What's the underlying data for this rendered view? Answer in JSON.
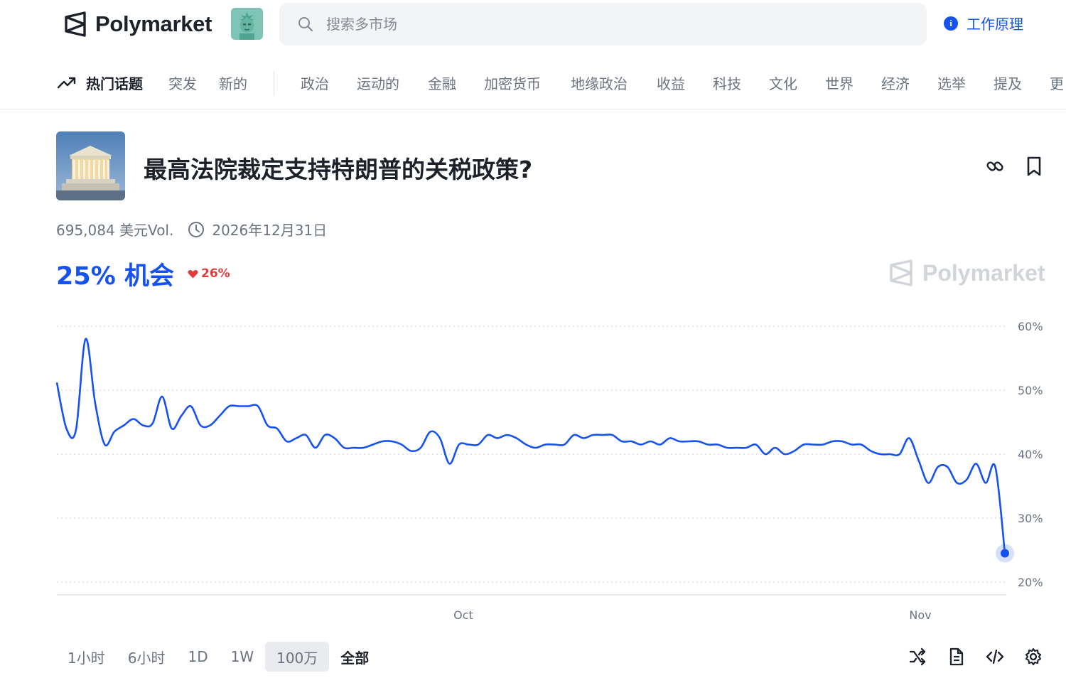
{
  "header": {
    "brand": "Polymarket",
    "search_placeholder": "搜索多市场",
    "how_it_works": "工作原理"
  },
  "nav": {
    "items": [
      {
        "label": "热门话题",
        "active": true
      },
      {
        "label": "突发"
      },
      {
        "label": "新的"
      },
      {
        "label": "政治"
      },
      {
        "label": "运动的"
      },
      {
        "label": "金融"
      },
      {
        "label": "加密货币"
      },
      {
        "label": "地缘政治"
      },
      {
        "label": "收益"
      },
      {
        "label": "科技"
      },
      {
        "label": "文化"
      },
      {
        "label": "世界"
      },
      {
        "label": "经济"
      },
      {
        "label": "选举"
      },
      {
        "label": "提及"
      },
      {
        "label": "更"
      }
    ]
  },
  "market": {
    "title": "最高法院裁定支持特朗普的关税政策?",
    "volume": "695,084 美元Vol.",
    "end_date": "2026年12月31日",
    "chance": "25% 机会",
    "change": "26%",
    "change_direction": "down",
    "watermark": "Polymarket"
  },
  "chart_data": {
    "type": "line",
    "title": "",
    "xlabel": "",
    "ylabel": "",
    "x_tick_labels": [
      "Oct",
      "Nov"
    ],
    "y_tick_labels": [
      "60%",
      "50%",
      "40%",
      "30%",
      "20%"
    ],
    "y_ticks": [
      60,
      50,
      40,
      30,
      20
    ],
    "ylim": [
      19,
      62
    ],
    "grid": true,
    "color": "#1652f0",
    "series": [
      {
        "values": [
          51.2,
          44,
          43.8,
          58,
          48,
          41.5,
          43.5,
          44.5,
          45.5,
          44.5,
          44.8,
          49,
          44,
          46,
          47.5,
          44.5,
          44.5,
          46,
          47.5,
          47.5,
          47.5,
          47.5,
          44.5,
          44,
          42,
          42.5,
          43,
          41,
          43,
          42.5,
          41,
          41,
          41,
          41.5,
          42,
          42,
          41.5,
          40.5,
          41,
          43.5,
          42.5,
          38.5,
          41.5,
          41.5,
          41.5,
          43,
          42.5,
          43,
          42.5,
          41.5,
          41,
          41.5,
          41.5,
          41.5,
          43,
          42.5,
          43,
          43,
          43,
          42,
          42,
          41.5,
          42,
          41.5,
          42.5,
          42,
          42,
          42,
          41.5,
          41.5,
          41,
          41,
          41,
          41.5,
          40,
          41,
          40,
          40.5,
          41.5,
          41.5,
          41.5,
          42,
          42,
          41.5,
          41.5,
          40.5,
          40,
          40,
          40,
          42.5,
          39,
          35.5,
          38,
          38,
          35.5,
          36,
          38.5,
          35.5,
          38,
          24.5
        ]
      }
    ],
    "last_value": 24.5
  },
  "range": {
    "options": [
      "1小时",
      "6小时",
      "1D",
      "1W",
      "100万",
      "全部"
    ],
    "selected": "100万"
  },
  "icons": {
    "brand": "polymarket-logo-icon",
    "search": "search-icon",
    "info": "info-icon",
    "trending": "trending-icon",
    "link": "link-icon",
    "bookmark": "bookmark-icon",
    "clock": "clock-icon",
    "shuffle": "shuffle-icon",
    "document": "document-icon",
    "code": "code-icon",
    "settings": "gear-icon"
  }
}
